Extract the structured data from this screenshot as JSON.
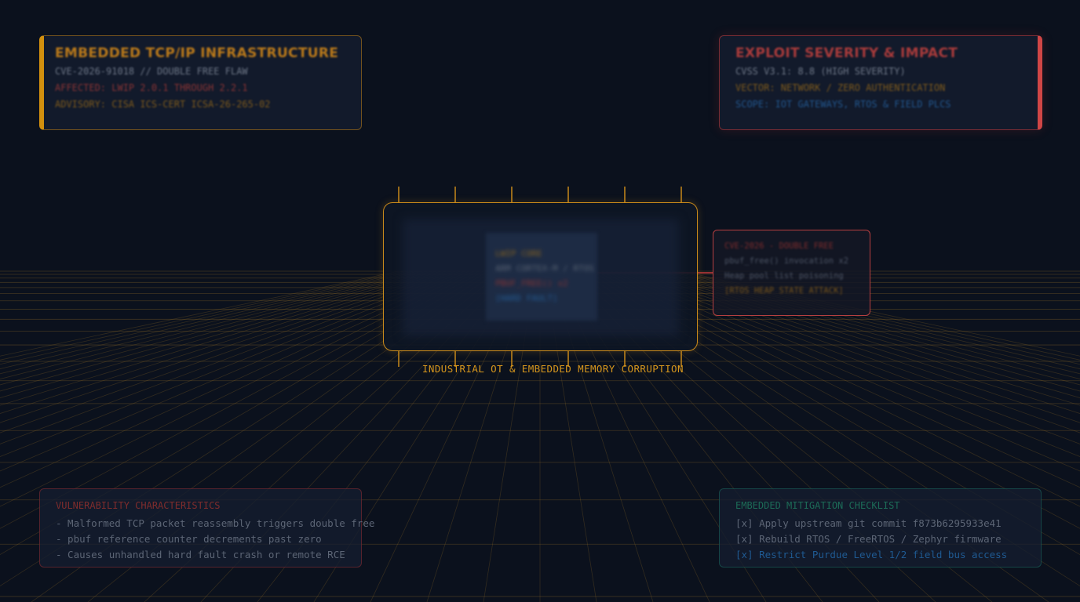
{
  "infra_panel": {
    "title": "EMBEDDED TCP/IP INFRASTRUCTURE",
    "lines": [
      "CVE-2026-91018 // DOUBLE FREE FLAW",
      "AFFECTED: LWIP 2.0.1 THROUGH 2.2.1",
      "ADVISORY: CISA ICS-CERT ICSA-26-265-02"
    ]
  },
  "severity_panel": {
    "title": "EXPLOIT SEVERITY & IMPACT",
    "lines": [
      "CVSS V3.1: 8.8 (HIGH SEVERITY)",
      "VECTOR: NETWORK / ZERO AUTHENTICATION",
      "SCOPE: IOT GATEWAYS, RTOS & FIELD PLCS"
    ]
  },
  "chip": {
    "core_lines": [
      "LWIP CORE",
      "ARM CORTEX-M / RTOS",
      "PBUF_FREE() x2",
      "[HARD FAULT]"
    ],
    "caption": "INDUSTRIAL OT & EMBEDDED MEMORY CORRUPTION"
  },
  "callout": {
    "lines": [
      "CVE-2026 - DOUBLE FREE",
      "pbuf_free() invocation x2",
      "Heap pool list poisoning",
      "[RTOS HEAP STATE ATTACK]"
    ]
  },
  "vuln_panel": {
    "title": "VULNERABILITY CHARACTERISTICS",
    "items": [
      "- Malformed TCP packet reassembly triggers double free",
      "- pbuf reference counter decrements past zero",
      "- Causes unhandled hard fault crash or remote RCE"
    ]
  },
  "mitigation_panel": {
    "title": "EMBEDDED MITIGATION CHECKLIST",
    "items": [
      "[x] Apply upstream git commit f873b6295933e41",
      "[x] Rebuild RTOS / FreeRTOS / Zephyr firmware",
      "[x] Restrict Purdue Level 1/2 field bus access"
    ]
  },
  "colors": {
    "background": "#0b111d",
    "amber": "#d2900e",
    "red": "#d04646",
    "teal": "#1f9a7c",
    "blue": "#2f7fd0",
    "grey_text": "#6b7585"
  }
}
